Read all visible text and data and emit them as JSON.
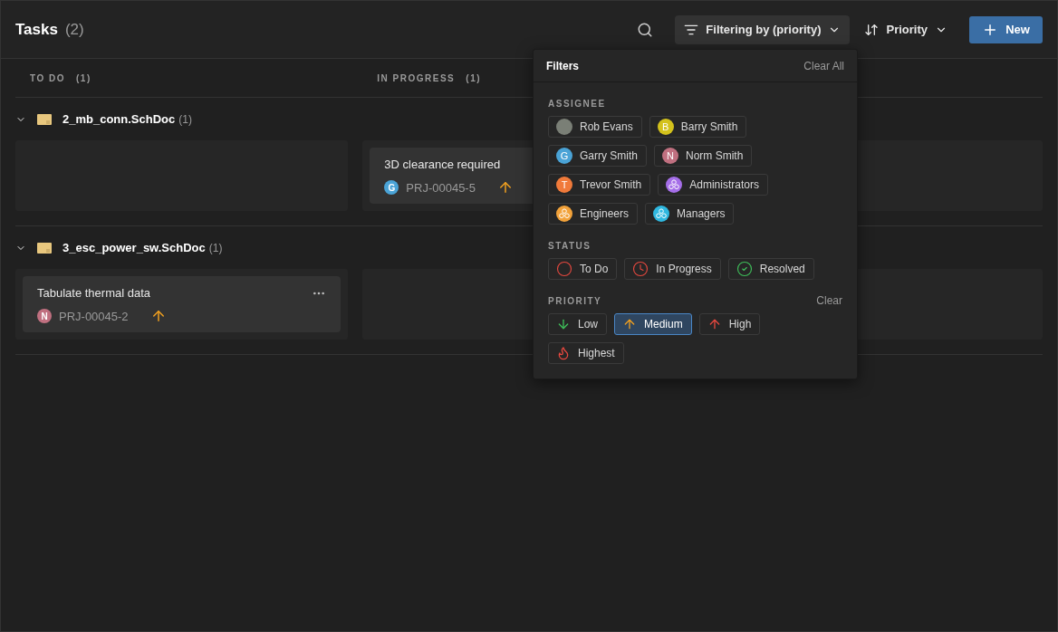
{
  "header": {
    "title": "Tasks",
    "count": "(2)",
    "filter_button": "Filtering by (priority)",
    "sort_button": "Priority",
    "new_button": "New"
  },
  "columns": [
    {
      "label": "TO DO",
      "count": "(1)"
    },
    {
      "label": "IN PROGRESS",
      "count": "(1)"
    }
  ],
  "groups": [
    {
      "name": "2_mb_conn.SchDoc",
      "count": "(1)",
      "expanded": true,
      "in_progress": [
        {
          "title": "3D clearance required",
          "id": "PRJ-00045-5",
          "assignee": "G",
          "color": "#4aa3d6",
          "kind": "medium"
        }
      ]
    },
    {
      "name": "3_esc_power_sw.SchDoc",
      "count": "(1)",
      "expanded": true,
      "todo": [
        {
          "title": "Tabulate thermal data",
          "id": "PRJ-00045-2",
          "assignee": "N",
          "color": "#c07080",
          "kind": "medium",
          "menu_shown": true
        }
      ]
    }
  ],
  "filters": {
    "title": "Filters",
    "clear_all": "Clear All",
    "sections": [
      {
        "label": "ASSIGNEE",
        "options": [
          {
            "label": "Rob Evans",
            "kind": "photo",
            "selected": false
          },
          {
            "label": "Barry Smith",
            "kind": "letter",
            "letter": "B",
            "color": "#d4c21c",
            "selected": false
          },
          {
            "label": "Garry Smith",
            "kind": "letter",
            "letter": "G",
            "color": "#4aa3d6",
            "selected": false
          },
          {
            "label": "Norm Smith",
            "kind": "letter",
            "letter": "N",
            "color": "#c07080",
            "selected": false
          },
          {
            "label": "Trevor Smith",
            "kind": "letter",
            "letter": "T",
            "color": "#f07a3a",
            "selected": false
          },
          {
            "label": "Administrators",
            "kind": "group",
            "color": "#a56ee8",
            "selected": false
          },
          {
            "label": "Engineers",
            "kind": "group",
            "color": "#f2a23a",
            "selected": false
          },
          {
            "label": "Managers",
            "kind": "group",
            "color": "#2fb8e0",
            "selected": false
          }
        ]
      },
      {
        "label": "STATUS",
        "options": [
          {
            "label": "To Do",
            "kind": "todo",
            "selected": false
          },
          {
            "label": "In Progress",
            "kind": "inprogress",
            "selected": false
          },
          {
            "label": "Resolved",
            "kind": "resolved",
            "selected": false
          }
        ]
      },
      {
        "label": "PRIORITY",
        "clear": "Clear",
        "options": [
          {
            "label": "Low",
            "kind": "low",
            "selected": false
          },
          {
            "label": "Medium",
            "kind": "medium",
            "selected": true
          },
          {
            "label": "High",
            "kind": "high",
            "selected": false
          },
          {
            "label": "Highest",
            "kind": "highest",
            "selected": false
          }
        ]
      }
    ]
  }
}
